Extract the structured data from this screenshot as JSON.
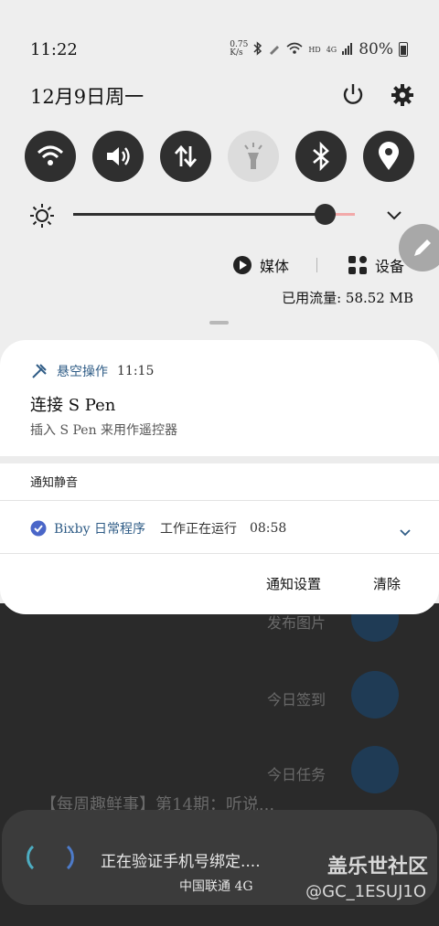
{
  "status_bar": {
    "time": "11:22",
    "net_speed_value": "0.75",
    "net_speed_unit": "K/s",
    "signal_label": "HD",
    "network_label": "4G",
    "battery": "80%"
  },
  "header": {
    "date": "12月9日周一"
  },
  "quick_settings": {
    "tiles": [
      {
        "icon": "wifi-icon",
        "state": "on"
      },
      {
        "icon": "sound-icon",
        "state": "on"
      },
      {
        "icon": "mobile-data-icon",
        "state": "on"
      },
      {
        "icon": "flashlight-icon",
        "state": "off"
      },
      {
        "icon": "bluetooth-icon",
        "state": "on"
      },
      {
        "icon": "location-icon",
        "state": "on"
      }
    ],
    "brightness_level": 0.93
  },
  "media_bar": {
    "media_label": "媒体",
    "devices_label": "设备",
    "data_usage": "已用流量: 58.52 MB"
  },
  "notifications": {
    "air_command": {
      "app": "悬空操作",
      "time": "11:15",
      "title": "连接 S Pen",
      "text": "插入 S Pen 来用作遥控器"
    },
    "silent_header": "通知静音",
    "bixby": {
      "app": "Bixby 日常程序",
      "text": "工作正在运行",
      "time": "08:58"
    },
    "actions": {
      "settings": "通知设置",
      "clear": "清除"
    }
  },
  "background_app": {
    "menu": [
      "发布图片",
      "今日签到",
      "今日任务"
    ],
    "post_title": "【每周趣鲜事】第14期：听说..."
  },
  "toast": {
    "text": "正在验证手机号绑定....",
    "carrier": "中国联通 4G"
  },
  "watermark": {
    "line1": "盖乐世社区",
    "line2": "@GC_1ESUJ1O"
  },
  "colors": {
    "accent_blue": "#2f5c86",
    "tile_on": "#2f2f2f",
    "tile_off": "#dcdcdc",
    "slider_rest": "#f2a9a9"
  }
}
